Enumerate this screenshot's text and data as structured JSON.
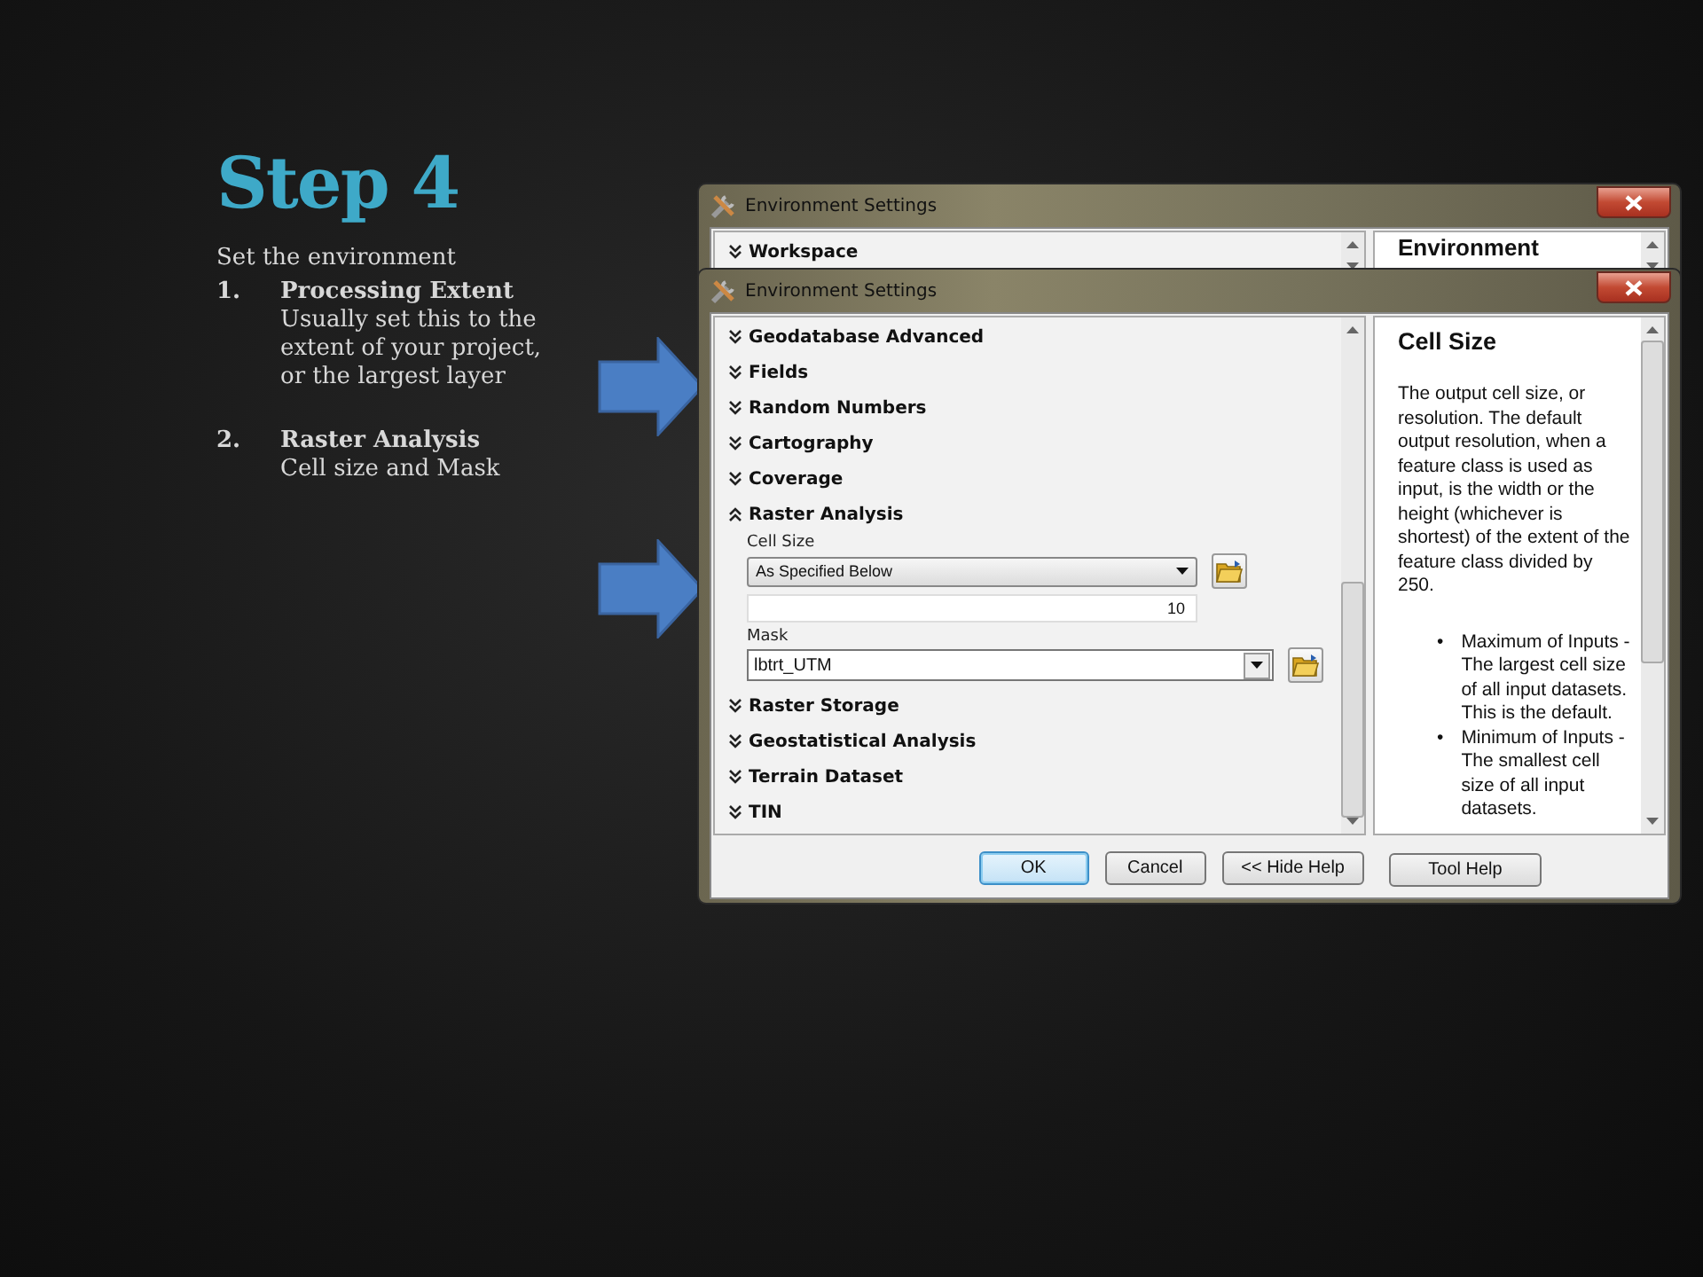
{
  "slide": {
    "title": "Step 4",
    "intro": "Set the environment",
    "steps": [
      {
        "number": "1.",
        "heading": "Processing Extent",
        "text": "Usually set this to the extent of your project, or the largest layer"
      },
      {
        "number": "2.",
        "heading": "Raster Analysis",
        "text": "Cell size and Mask"
      }
    ]
  },
  "back_window": {
    "title": "Environment Settings",
    "first_section": "Workspace",
    "help_title": "Environment"
  },
  "window": {
    "title": "Environment Settings",
    "sections": [
      {
        "label": "Geodatabase Advanced",
        "expanded": false
      },
      {
        "label": "Fields",
        "expanded": false
      },
      {
        "label": "Random Numbers",
        "expanded": false
      },
      {
        "label": "Cartography",
        "expanded": false
      },
      {
        "label": "Coverage",
        "expanded": false
      },
      {
        "label": "Raster Analysis",
        "expanded": true,
        "fields": [
          {
            "kind": "dropdown",
            "label": "Cell Size",
            "value": "As Specified Below"
          },
          {
            "kind": "number",
            "value": "10"
          },
          {
            "kind": "combo",
            "label": "Mask",
            "value": "lbtrt_UTM"
          }
        ]
      },
      {
        "label": "Raster Storage",
        "expanded": false
      },
      {
        "label": "Geostatistical Analysis",
        "expanded": false
      },
      {
        "label": "Terrain Dataset",
        "expanded": false
      },
      {
        "label": "TIN",
        "expanded": false
      }
    ],
    "help": {
      "title": "Cell Size",
      "paragraph": "The output cell size, or resolution. The default output resolution, when a feature class is used as input, is the width or the height (whichever is shortest) of the extent of the feature class divided by 250.",
      "bullets": [
        {
          "marker": "•",
          "text": "Maximum of Inputs - The largest cell size of all input datasets. This is the default."
        },
        {
          "marker": "•",
          "text": "Minimum of Inputs - The smallest cell size of all input datasets."
        }
      ]
    },
    "buttons": [
      {
        "label": "OK",
        "default": true
      },
      {
        "label": "Cancel",
        "default": false
      },
      {
        "label": "<< Hide Help",
        "default": false
      }
    ],
    "help_button": "Tool Help"
  }
}
